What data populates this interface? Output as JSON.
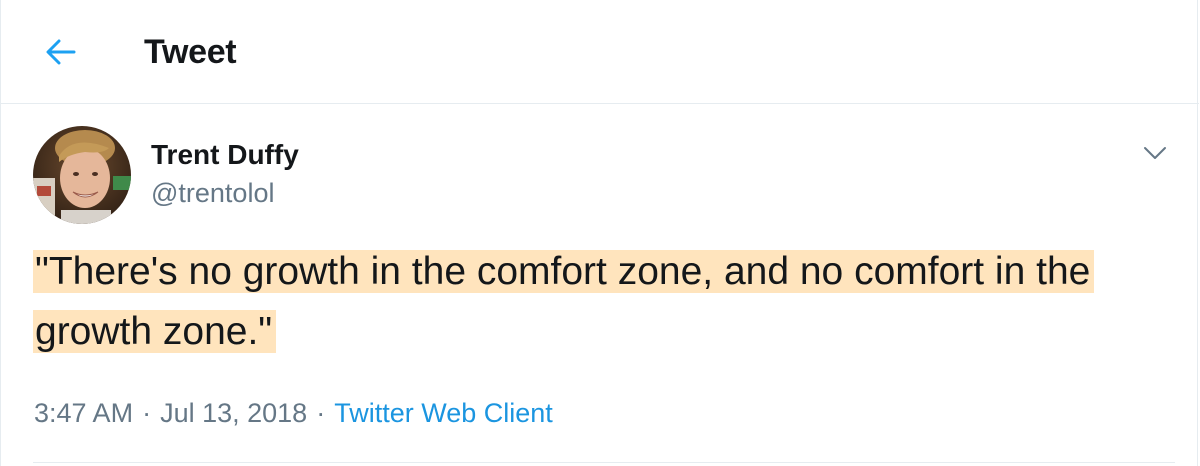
{
  "header": {
    "title": "Tweet",
    "back_icon": "arrow-left-icon"
  },
  "tweet": {
    "author": {
      "name": "Trent Duffy",
      "handle": "@trentolol",
      "avatar_icon": "avatar"
    },
    "text": "\"There's no growth in the comfort zone, and no comfort in the growth zone.\"",
    "time": "3:47 AM",
    "date": "Jul 13, 2018",
    "separator": "·",
    "client": "Twitter Web Client",
    "menu_icon": "chevron-down-icon"
  },
  "colors": {
    "accent": "#1da1f2",
    "secondary_text": "#657786",
    "highlight": "#ffe4bd",
    "divider": "#e6ecf0"
  }
}
